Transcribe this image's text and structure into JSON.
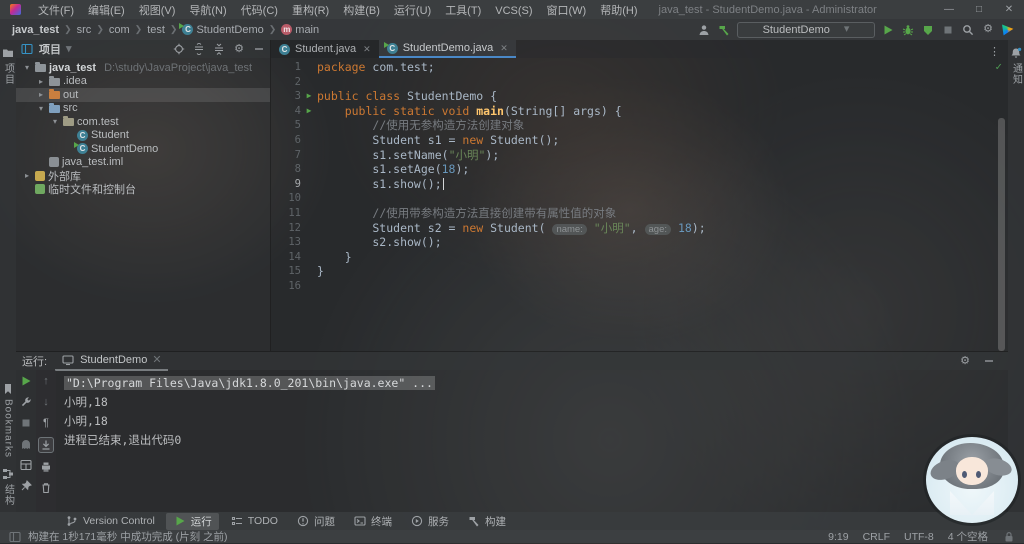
{
  "title_bar": {
    "menus": [
      "文件(F)",
      "编辑(E)",
      "视图(V)",
      "导航(N)",
      "代码(C)",
      "重构(R)",
      "构建(B)",
      "运行(U)",
      "工具(T)",
      "VCS(S)",
      "窗口(W)",
      "帮助(H)"
    ],
    "title": "java_test - StudentDemo.java - Administrator",
    "minimize": "—",
    "maximize": "□",
    "close": "✕"
  },
  "breadcrumbs": [
    {
      "label": "java_test",
      "icon": null,
      "bold": true
    },
    {
      "label": "src",
      "icon": null
    },
    {
      "label": "com",
      "icon": null
    },
    {
      "label": "test",
      "icon": null
    },
    {
      "label": "StudentDemo",
      "icon": "class-run"
    },
    {
      "label": "main",
      "icon": "method"
    }
  ],
  "run_widget": {
    "config": "StudentDemo"
  },
  "left_stripe": {
    "project": "项目",
    "bookmarks": "Bookmarks",
    "structure": "结构"
  },
  "right_stripe": {
    "notifications": "通知"
  },
  "project_panel": {
    "header": "项目",
    "tree": [
      {
        "indent": 0,
        "twist": "▾",
        "icon": "folder",
        "color": "#8e9499",
        "label": "java_test",
        "bold": true,
        "extra": "D:\\study\\JavaProject\\java_test"
      },
      {
        "indent": 1,
        "twist": "▸",
        "icon": "folder",
        "color": "#8e9499",
        "label": ".idea"
      },
      {
        "indent": 1,
        "twist": "▸",
        "icon": "folder",
        "color": "#c97f3f",
        "label": "out",
        "selected": true
      },
      {
        "indent": 1,
        "twist": "▾",
        "icon": "folder",
        "color": "#7fa0be",
        "label": "src"
      },
      {
        "indent": 2,
        "twist": "▾",
        "icon": "package",
        "color": "#9e9b84",
        "label": "com.test"
      },
      {
        "indent": 3,
        "twist": "",
        "icon": "class",
        "color": "",
        "label": "Student"
      },
      {
        "indent": 3,
        "twist": "",
        "icon": "class-run",
        "color": "",
        "label": "StudentDemo"
      },
      {
        "indent": 1,
        "twist": "",
        "icon": "iml",
        "color": "#8a8f94",
        "label": "java_test.iml"
      },
      {
        "indent": 0,
        "twist": "▸",
        "icon": "library",
        "color": "#c7a94f",
        "label": "外部库"
      },
      {
        "indent": 0,
        "twist": "",
        "icon": "scratch",
        "color": "#6fa860",
        "label": "临时文件和控制台"
      }
    ]
  },
  "editor": {
    "tabs": [
      {
        "label": "Student.java",
        "icon": "class",
        "close": "✕",
        "active": false
      },
      {
        "label": "StudentDemo.java",
        "icon": "class-run",
        "close": "✕",
        "active": true
      }
    ],
    "inspection_ok": "✓",
    "lines": [
      {
        "num": "1",
        "run": false,
        "segs": [
          [
            "kw",
            "package"
          ],
          [
            "pl",
            " com.test;"
          ]
        ]
      },
      {
        "num": "2",
        "run": false,
        "segs": []
      },
      {
        "num": "3",
        "run": true,
        "segs": [
          [
            "kw",
            "public class"
          ],
          [
            "pl",
            " StudentDemo {"
          ]
        ]
      },
      {
        "num": "4",
        "run": true,
        "segs": [
          [
            "pl",
            "    "
          ],
          [
            "kw",
            "public static void"
          ],
          [
            "fn",
            " main"
          ],
          [
            "pl",
            "(String[] args) {"
          ]
        ]
      },
      {
        "num": "5",
        "run": false,
        "segs": [
          [
            "pl",
            "        "
          ],
          [
            "cm",
            "//使用无参构造方法创建对象"
          ]
        ]
      },
      {
        "num": "6",
        "run": false,
        "segs": [
          [
            "pl",
            "        Student s1 = "
          ],
          [
            "kw",
            "new"
          ],
          [
            "pl",
            " Student();"
          ]
        ]
      },
      {
        "num": "7",
        "run": false,
        "segs": [
          [
            "pl",
            "        s1.setName("
          ],
          [
            "st",
            "\"小明\""
          ],
          [
            "pl",
            ");"
          ]
        ]
      },
      {
        "num": "8",
        "run": false,
        "segs": [
          [
            "pl",
            "        s1.setAge("
          ],
          [
            "num",
            "18"
          ],
          [
            "pl",
            ");"
          ]
        ]
      },
      {
        "num": "9",
        "run": false,
        "current": true,
        "caret": true,
        "segs": [
          [
            "pl",
            "        s1.show();"
          ]
        ]
      },
      {
        "num": "10",
        "run": false,
        "segs": []
      },
      {
        "num": "11",
        "run": false,
        "segs": [
          [
            "pl",
            "        "
          ],
          [
            "cm",
            "//使用带参构造方法直接创建带有属性值的对象"
          ]
        ]
      },
      {
        "num": "12",
        "run": false,
        "segs": [
          [
            "pl",
            "        Student s2 = "
          ],
          [
            "kw",
            "new"
          ],
          [
            "pl",
            " Student( "
          ],
          [
            "hint",
            "name:"
          ],
          [
            "pl",
            " "
          ],
          [
            "st",
            "\"小明\""
          ],
          [
            "pl",
            ", "
          ],
          [
            "hint",
            "age:"
          ],
          [
            "pl",
            " "
          ],
          [
            "num",
            "18"
          ],
          [
            "pl",
            ");"
          ]
        ]
      },
      {
        "num": "13",
        "run": false,
        "segs": [
          [
            "pl",
            "        s2.show();"
          ]
        ]
      },
      {
        "num": "14",
        "run": false,
        "segs": [
          [
            "pl",
            "    }"
          ]
        ]
      },
      {
        "num": "15",
        "run": false,
        "segs": [
          [
            "pl",
            "}"
          ]
        ]
      },
      {
        "num": "16",
        "run": false,
        "segs": []
      }
    ]
  },
  "run_panel": {
    "label": "运行:",
    "tab": "StudentDemo",
    "tab_close": "✕",
    "console": [
      {
        "text": "\"D:\\Program Files\\Java\\jdk1.8.0_201\\bin\\java.exe\" ...",
        "selected": true
      },
      {
        "text": "小明,18"
      },
      {
        "text": "小明,18"
      },
      {
        "text": ""
      },
      {
        "text": "进程已结束,退出代码0"
      }
    ]
  },
  "bottom_bar": {
    "items": [
      {
        "icon": "branch",
        "label": "Version Control"
      },
      {
        "icon": "play",
        "label": "运行",
        "active": true
      },
      {
        "icon": "todo",
        "label": "TODO"
      },
      {
        "icon": "error",
        "label": "问题"
      },
      {
        "icon": "terminal",
        "label": "终端"
      },
      {
        "icon": "services",
        "label": "服务"
      },
      {
        "icon": "hammer",
        "label": "构建"
      }
    ]
  },
  "status_bar": {
    "message": "构建在 1秒171毫秒 中成功完成 (片刻 之前)",
    "right": [
      "9:19",
      "CRLF",
      "UTF-8",
      "4 个空格"
    ]
  },
  "colors": {
    "accent_blue": "#4a88c7",
    "run_green": "#57a64a",
    "selection": "#4b5052"
  }
}
